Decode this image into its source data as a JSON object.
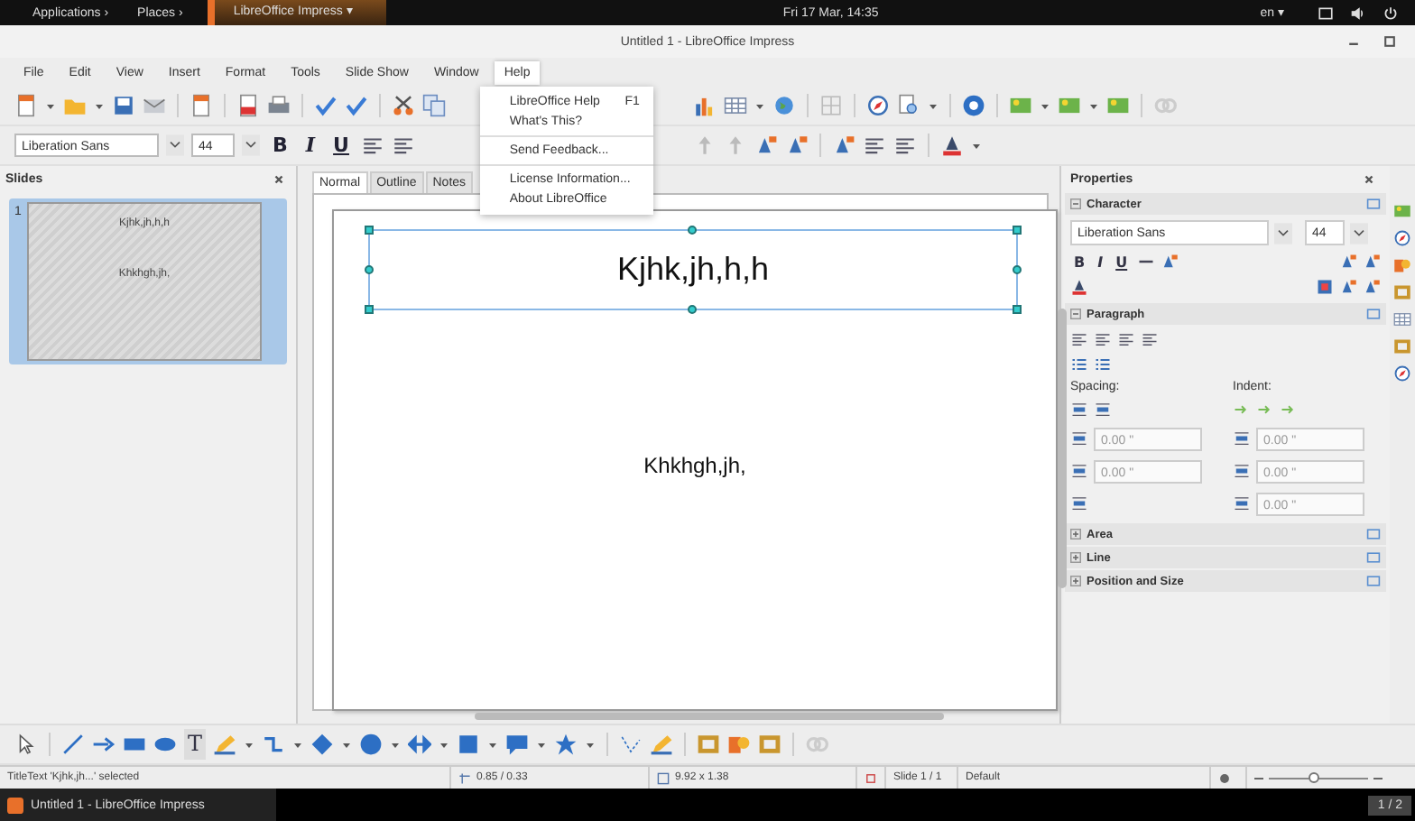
{
  "top_bar": {
    "menus": [
      "Applications ›",
      "Places ›"
    ],
    "active_app": "LibreOffice Impress ▾",
    "clock": "Fri 17 Mar, 14:35",
    "keyboard": "en ▾"
  },
  "window": {
    "title": "Untitled 1 - LibreOffice Impress"
  },
  "menu_bar": [
    {
      "label": "File",
      "open": false
    },
    {
      "label": "Edit",
      "open": false
    },
    {
      "label": "View",
      "open": false
    },
    {
      "label": "Insert",
      "open": false
    },
    {
      "label": "Format",
      "open": false
    },
    {
      "label": "Tools",
      "open": false
    },
    {
      "label": "Slide Show",
      "open": false
    },
    {
      "label": "Window",
      "open": false
    },
    {
      "label": "Help",
      "open": true
    }
  ],
  "help_menu": [
    [
      {
        "label": "LibreOffice Help",
        "shortcut": "F1"
      },
      {
        "label": "What's This?"
      }
    ],
    [
      {
        "label": "Send Feedback..."
      }
    ],
    [
      {
        "label": "License Information..."
      },
      {
        "label": "About LibreOffice"
      }
    ]
  ],
  "formatting": {
    "font": "Liberation Sans",
    "size": "44",
    "buttons": [
      "B",
      "I",
      "U"
    ]
  },
  "slides_panel": {
    "title": "Slides",
    "slides": [
      {
        "number": "1",
        "title": "Kjhk,jh,h,h",
        "body": "Khkhgh,jh,",
        "selected": true
      }
    ]
  },
  "view_tabs": [
    {
      "label": "Normal",
      "selected": true
    },
    {
      "label": "Outline",
      "selected": false
    },
    {
      "label": "Notes",
      "selected": false
    }
  ],
  "slide": {
    "title": "Kjhk,jh,h,h",
    "title_selected": true,
    "body": "Khkhgh,jh,"
  },
  "properties": {
    "title": "Properties",
    "sections": [
      {
        "kind": "character",
        "title": "Character",
        "expanded": true,
        "font": "Liberation Sans",
        "size": "44",
        "buttons": [
          "B",
          "I",
          "U"
        ]
      },
      {
        "kind": "paragraph",
        "title": "Paragraph",
        "expanded": true,
        "spacing_label": "Spacing:",
        "indent_label": "Indent:",
        "spacing_fields": [
          "0.00 \"",
          "0.00 \""
        ],
        "indent_fields": [
          "0.00 \"",
          "0.00 \"",
          "0.00 \""
        ]
      },
      {
        "title": "Area",
        "expanded": false
      },
      {
        "title": "Line",
        "expanded": false
      },
      {
        "title": "Position and Size",
        "expanded": false
      }
    ]
  },
  "drawing_toolbar": {
    "text_tool": "T"
  },
  "status_bar": {
    "selection": "TitleText 'Kjhk,jh...' selected",
    "position": "0.85 / 0.33",
    "size": "9.92 x 1.38",
    "slide": "Slide 1 / 1",
    "layout": "Default",
    "zoom": {
      "level": 0.45
    }
  },
  "taskbar": {
    "window": "Untitled 1 - LibreOffice Impress",
    "workspace": "1 / 2"
  }
}
